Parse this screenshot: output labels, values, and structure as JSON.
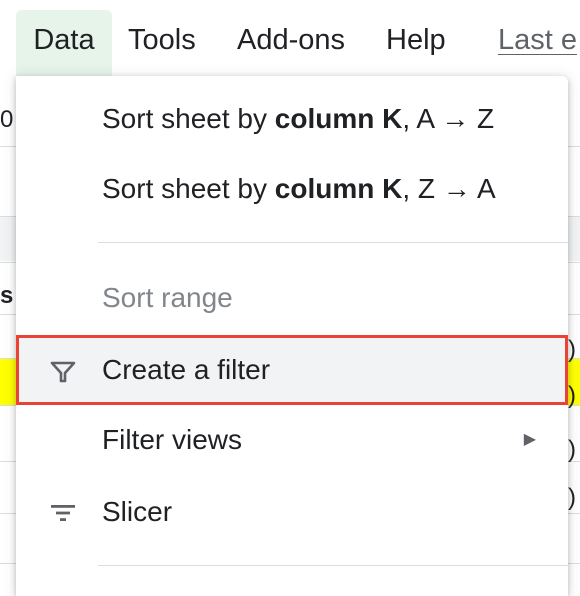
{
  "menubar": {
    "items": [
      {
        "label": "Data"
      },
      {
        "label": "Tools"
      },
      {
        "label": "Add-ons"
      },
      {
        "label": "Help"
      },
      {
        "label": "Last e"
      }
    ]
  },
  "background": {
    "left_glyphs": [
      "0",
      "s"
    ],
    "right_glyphs": [
      ")",
      ")",
      ")",
      ")"
    ]
  },
  "dropdown": {
    "sort_az": {
      "prefix": "Sort sheet by ",
      "bold": "column K",
      "suffix": ", A → Z"
    },
    "sort_za": {
      "prefix": "Sort sheet by ",
      "bold": "column K",
      "suffix": ", Z → A"
    },
    "sort_range": "Sort range",
    "create_filter": "Create a filter",
    "filter_views": "Filter views",
    "slicer": "Slicer",
    "submenu_arrow": "▶",
    "icons": {
      "create_filter": "filter-funnel-icon",
      "slicer": "slicer-lines-icon",
      "filter_views": "submenu-arrow-icon"
    }
  },
  "colors": {
    "menu_active_bg": "#e6f4ea",
    "highlight_border": "#ea4335",
    "highlight_bg": "#f1f3f4",
    "row_yellow": "#ffff00",
    "text": "#202124",
    "disabled_text": "#80868b"
  }
}
